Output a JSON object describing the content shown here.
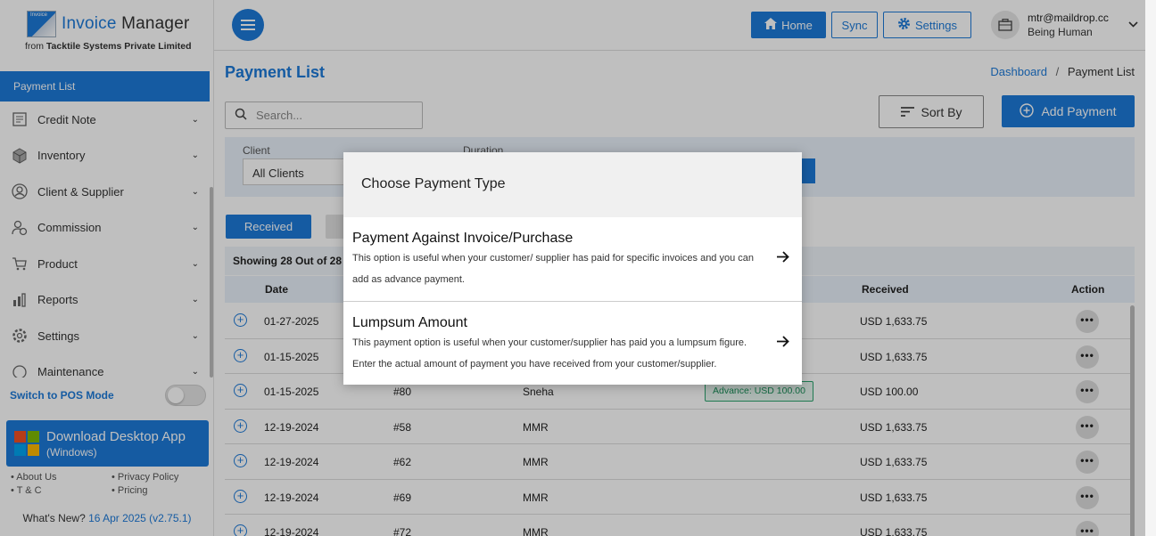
{
  "sidebar": {
    "logo_small": "Invoice",
    "logo_title_a": "Invoice",
    "logo_title_b": "Manager",
    "logo_sub_a": "from",
    "logo_sub_b": "Tacktile Systems Private Limited",
    "active_item": "Payment List",
    "items": [
      {
        "label": "Credit Note",
        "icon": "credit-note-icon"
      },
      {
        "label": "Inventory",
        "icon": "inventory-icon"
      },
      {
        "label": "Client & Supplier",
        "icon": "client-icon"
      },
      {
        "label": "Commission",
        "icon": "commission-icon"
      },
      {
        "label": "Product",
        "icon": "product-icon"
      },
      {
        "label": "Reports",
        "icon": "reports-icon"
      },
      {
        "label": "Settings",
        "icon": "settings-icon"
      },
      {
        "label": "Maintenance",
        "icon": "maintenance-icon"
      }
    ],
    "pos_label": "Switch to POS Mode",
    "download_line1": "Download Desktop App",
    "download_line2": "(Windows)",
    "links": [
      "• About Us",
      "• Privacy Policy",
      "• T & C",
      "• Pricing"
    ],
    "whats_new_label": "What's New?",
    "whats_new_value": "16 Apr 2025 (v2.75.1)"
  },
  "topbar": {
    "home": "Home",
    "sync": "Sync",
    "settings": "Settings",
    "email": "mtr@maildrop.cc",
    "user_name": "Being Human"
  },
  "main": {
    "title": "Payment List",
    "crumb_link": "Dashboard",
    "crumb_sep": "/",
    "crumb_current": "Payment List",
    "search_placeholder": "Search...",
    "sort_label": "Sort By",
    "add_label": "Add Payment",
    "filter_client_label": "Client",
    "filter_duration_label": "Duration",
    "filter_client_value": "All Clients",
    "tab_received": "Received",
    "showing": "Showing 28 Out of 28",
    "columns": {
      "date": "Date",
      "received": "Received",
      "action": "Action"
    },
    "rows": [
      {
        "date": "01-27-2025",
        "no": "",
        "client": "",
        "received": "USD 1,633.75"
      },
      {
        "date": "01-15-2025",
        "no": "",
        "client": "",
        "received": "USD 1,633.75"
      },
      {
        "date": "01-15-2025",
        "no": "#80",
        "client": "Sneha",
        "received": "USD 100.00",
        "badge_label": "Advance:",
        "badge_value": "USD 100.00"
      },
      {
        "date": "12-19-2024",
        "no": "#58",
        "client": "MMR",
        "received": "USD 1,633.75"
      },
      {
        "date": "12-19-2024",
        "no": "#62",
        "client": "MMR",
        "received": "USD 1,633.75"
      },
      {
        "date": "12-19-2024",
        "no": "#69",
        "client": "MMR",
        "received": "USD 1,633.75"
      },
      {
        "date": "12-19-2024",
        "no": "#72",
        "client": "MMR",
        "received": "USD 1,633.75"
      }
    ]
  },
  "modal": {
    "title": "Choose Payment Type",
    "options": [
      {
        "title": "Payment Against Invoice/Purchase",
        "desc": "This option is useful when your customer/ supplier has paid for specific invoices and you can add as advance payment."
      },
      {
        "title": "Lumpsum Amount",
        "desc": "This payment option is useful when your customer/supplier has paid you a lumpsum figure. Enter the actual amount of payment you have received from your customer/supplier."
      }
    ]
  },
  "colors": {
    "accent": "#1d7ad9",
    "advance_badge": "#1a8f5a"
  }
}
